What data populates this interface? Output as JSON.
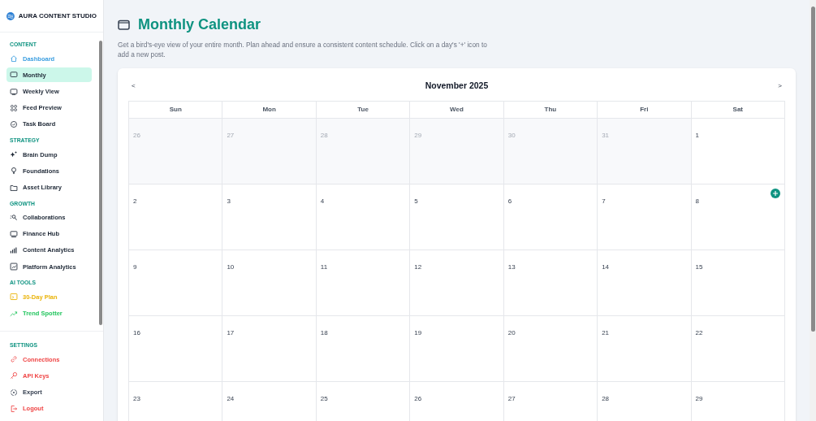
{
  "brand": {
    "name": "AURA CONTENT STUDIO"
  },
  "sidebar": {
    "sections": [
      {
        "title": "CONTENT",
        "items": [
          {
            "label": "Dashboard",
            "selected": false,
            "color": "#3b9ee0"
          },
          {
            "label": "Monthly",
            "selected": true,
            "color": "#1f2937"
          },
          {
            "label": "Weekly View",
            "selected": false,
            "color": "#1f2937"
          },
          {
            "label": "Feed Preview",
            "selected": false,
            "color": "#1f2937"
          },
          {
            "label": "Task Board",
            "selected": false,
            "color": "#1f2937"
          }
        ]
      },
      {
        "title": "STRATEGY",
        "items": [
          {
            "label": "Brain Dump",
            "selected": false,
            "color": "#1f2937"
          },
          {
            "label": "Foundations",
            "selected": false,
            "color": "#1f2937"
          },
          {
            "label": "Asset Library",
            "selected": false,
            "color": "#1f2937"
          }
        ]
      },
      {
        "title": "GROWTH",
        "items": [
          {
            "label": "Collaborations",
            "selected": false,
            "color": "#1f2937"
          },
          {
            "label": "Finance Hub",
            "selected": false,
            "color": "#1f2937"
          },
          {
            "label": "Content Analytics",
            "selected": false,
            "color": "#1f2937"
          },
          {
            "label": "Platform Analytics",
            "selected": false,
            "color": "#1f2937"
          }
        ]
      },
      {
        "title": "AI TOOLS",
        "items": [
          {
            "label": "30-Day Plan",
            "selected": false,
            "color": "#eab308"
          },
          {
            "label": "Trend Spotter",
            "selected": false,
            "color": "#22c55e"
          }
        ]
      }
    ],
    "settings": {
      "title": "SETTINGS",
      "items": [
        {
          "label": "Connections",
          "selected": false,
          "color": "#ef4444"
        },
        {
          "label": "API Keys",
          "selected": false,
          "color": "#ef4444"
        },
        {
          "label": "Export",
          "selected": false,
          "color": "#374151"
        },
        {
          "label": "Logout",
          "selected": false,
          "color": "#ef4444"
        }
      ]
    }
  },
  "page": {
    "title": "Monthly Calendar",
    "description": "Get a bird's-eye view of your entire month. Plan ahead and ensure a consistent content schedule. Click on a day's '+' icon to add a new post."
  },
  "calendar": {
    "prev": "<",
    "month": "November 2025",
    "next": ">",
    "weekdays": [
      "Sun",
      "Mon",
      "Tue",
      "Wed",
      "Thu",
      "Fri",
      "Sat"
    ],
    "days": [
      {
        "label": "26",
        "outside": true,
        "hovered": false
      },
      {
        "label": "27",
        "outside": true,
        "hovered": false
      },
      {
        "label": "28",
        "outside": true,
        "hovered": false
      },
      {
        "label": "29",
        "outside": true,
        "hovered": false
      },
      {
        "label": "30",
        "outside": true,
        "hovered": false
      },
      {
        "label": "31",
        "outside": true,
        "hovered": false
      },
      {
        "label": "1",
        "outside": false,
        "hovered": false
      },
      {
        "label": "2",
        "outside": false,
        "hovered": false
      },
      {
        "label": "3",
        "outside": false,
        "hovered": false
      },
      {
        "label": "4",
        "outside": false,
        "hovered": false
      },
      {
        "label": "5",
        "outside": false,
        "hovered": false
      },
      {
        "label": "6",
        "outside": false,
        "hovered": false
      },
      {
        "label": "7",
        "outside": false,
        "hovered": false
      },
      {
        "label": "8",
        "outside": false,
        "hovered": true
      },
      {
        "label": "9",
        "outside": false,
        "hovered": false
      },
      {
        "label": "10",
        "outside": false,
        "hovered": false
      },
      {
        "label": "11",
        "outside": false,
        "hovered": false
      },
      {
        "label": "12",
        "outside": false,
        "hovered": false
      },
      {
        "label": "13",
        "outside": false,
        "hovered": false
      },
      {
        "label": "14",
        "outside": false,
        "hovered": false
      },
      {
        "label": "15",
        "outside": false,
        "hovered": false
      },
      {
        "label": "16",
        "outside": false,
        "hovered": false
      },
      {
        "label": "17",
        "outside": false,
        "hovered": false
      },
      {
        "label": "18",
        "outside": false,
        "hovered": false
      },
      {
        "label": "19",
        "outside": false,
        "hovered": false
      },
      {
        "label": "20",
        "outside": false,
        "hovered": false
      },
      {
        "label": "21",
        "outside": false,
        "hovered": false
      },
      {
        "label": "22",
        "outside": false,
        "hovered": false
      },
      {
        "label": "23",
        "outside": false,
        "hovered": false
      },
      {
        "label": "24",
        "outside": false,
        "hovered": false
      },
      {
        "label": "25",
        "outside": false,
        "hovered": false
      },
      {
        "label": "26",
        "outside": false,
        "hovered": false
      },
      {
        "label": "27",
        "outside": false,
        "hovered": false
      },
      {
        "label": "28",
        "outside": false,
        "hovered": false
      },
      {
        "label": "29",
        "outside": false,
        "hovered": false
      }
    ]
  }
}
